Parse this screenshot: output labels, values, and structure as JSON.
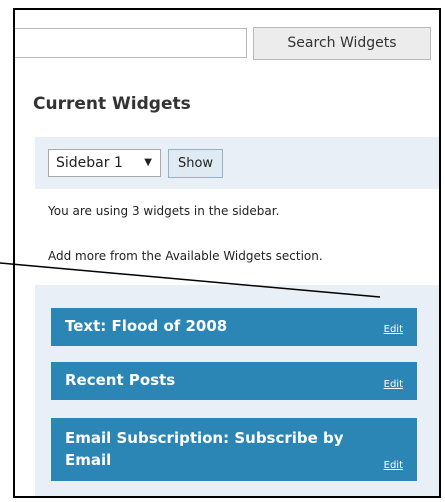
{
  "search": {
    "button_label": "Search Widgets",
    "input_value": ""
  },
  "current_widgets": {
    "title": "Current Widgets",
    "sidebar_select": {
      "selected": "Sidebar 1"
    },
    "show_label": "Show",
    "info_line1": "You are using 3 widgets in the sidebar.",
    "info_line2": "Add more from the Available Widgets section."
  },
  "widgets": [
    {
      "title": "Text: Flood of 2008",
      "edit_label": "Edit"
    },
    {
      "title": "Recent Posts",
      "edit_label": "Edit"
    },
    {
      "title": "Email Subscription: Subscribe by Email",
      "edit_label": "Edit"
    }
  ],
  "colors": {
    "widget_bg": "#2b86b5",
    "panel_bg": "#e8eff6",
    "frame_border": "#000000"
  }
}
